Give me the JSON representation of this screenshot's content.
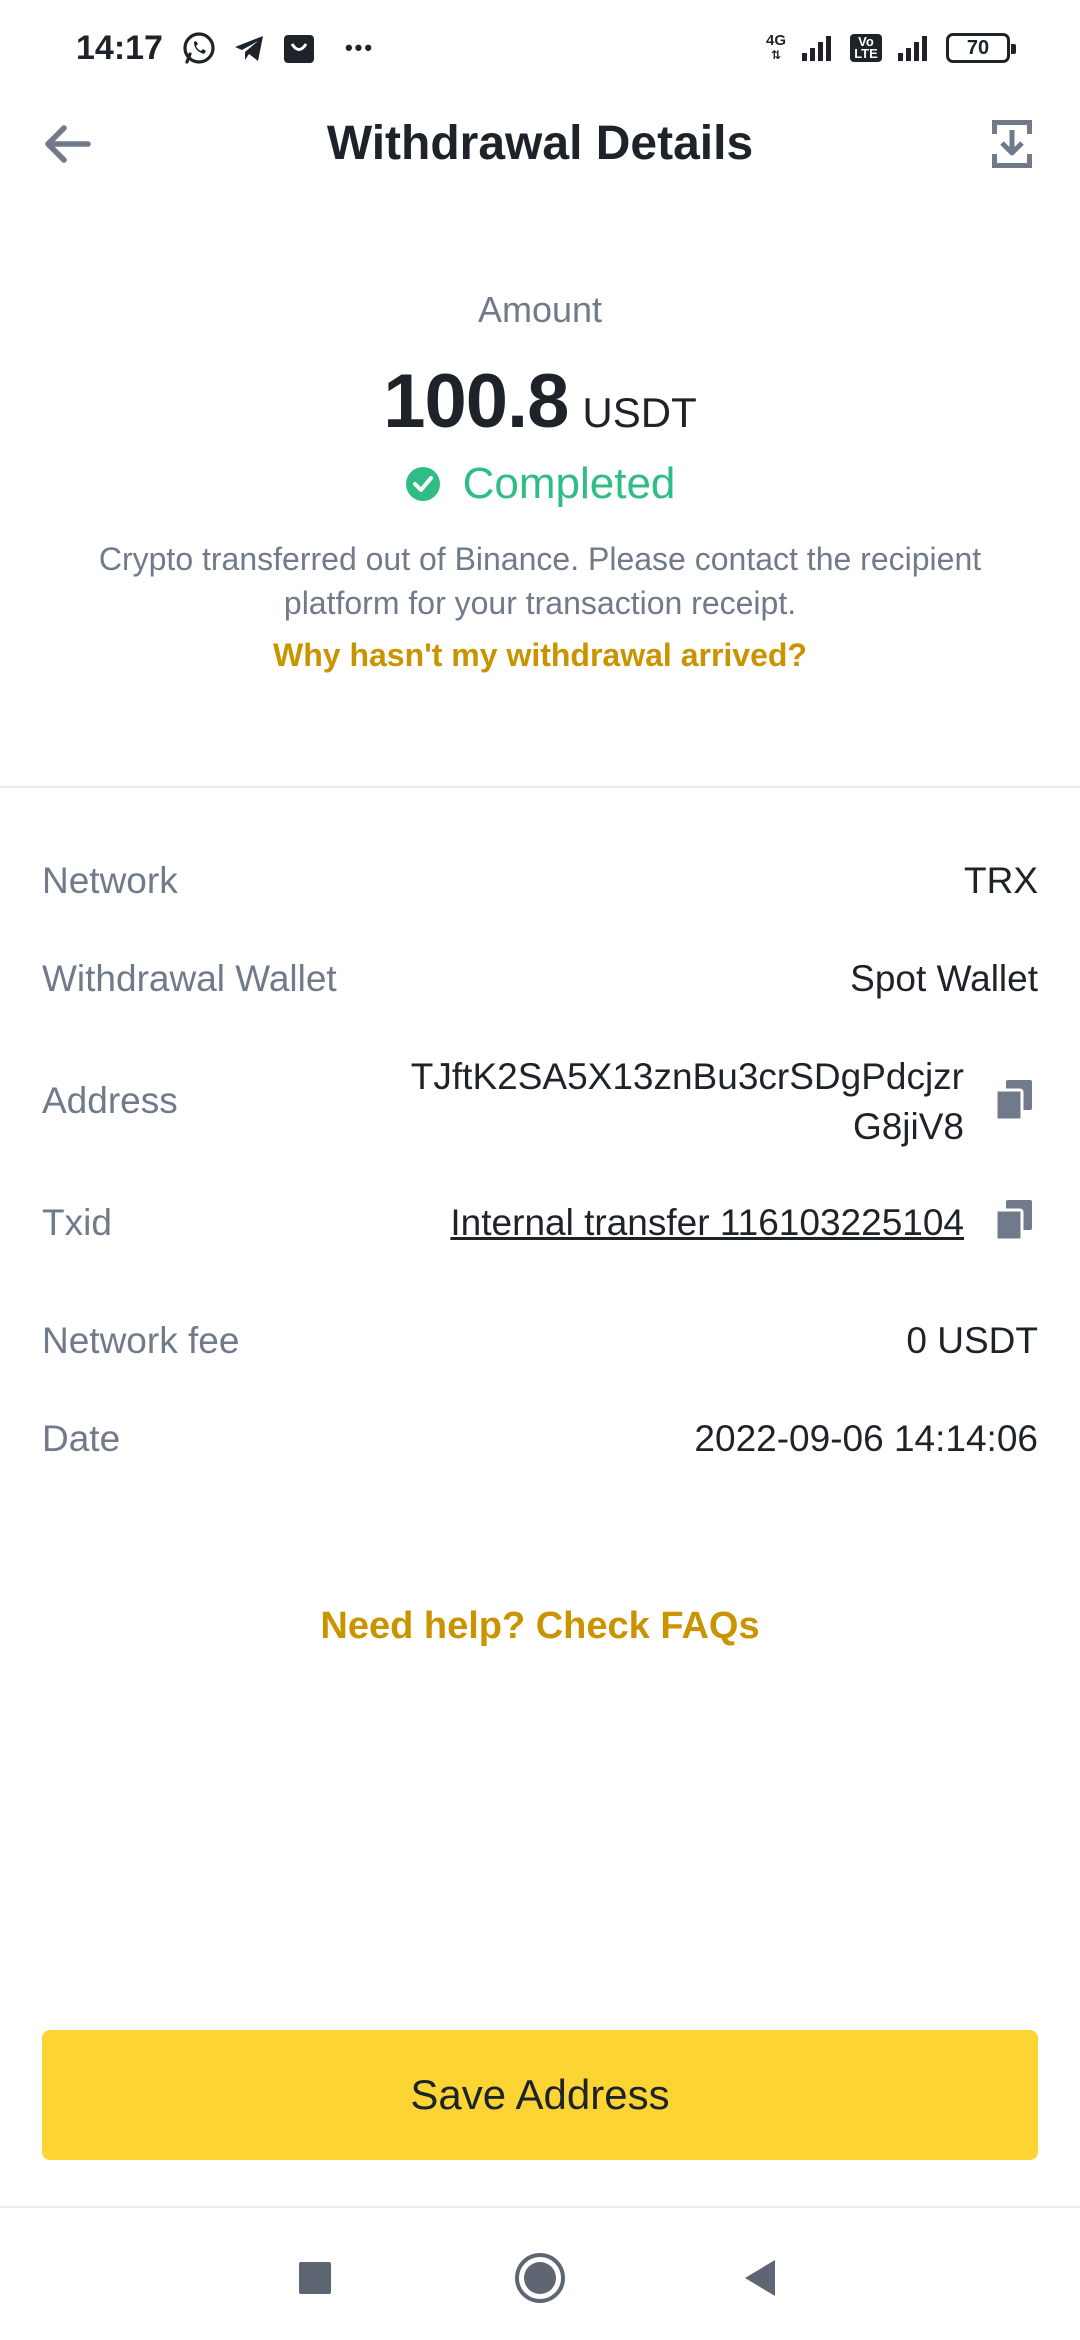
{
  "status_bar": {
    "time": "14:17",
    "network_label": "4G",
    "volte_label_top": "Vo",
    "volte_label_bottom": "LTE",
    "battery": "70",
    "more_glyph": "•••"
  },
  "header": {
    "title": "Withdrawal Details",
    "back_icon": "arrow-left-icon",
    "download_icon": "download-icon"
  },
  "summary": {
    "amount_label": "Amount",
    "amount_value": "100.8",
    "amount_unit": "USDT",
    "status": "Completed",
    "status_color": "#2ebd85",
    "notice": "Crypto transferred out of Binance. Please contact the recipient platform for your transaction receipt.",
    "why_link": "Why hasn't my withdrawal arrived?"
  },
  "details": {
    "network": {
      "label": "Network",
      "value": "TRX"
    },
    "wallet": {
      "label": "Withdrawal Wallet",
      "value": "Spot Wallet"
    },
    "address": {
      "label": "Address",
      "value": "TJftK2SA5X13znBu3crSDgPdcjzrG8jiV8"
    },
    "txid": {
      "label": "Txid",
      "value": "Internal transfer 116103225104"
    },
    "fee": {
      "label": "Network fee",
      "value": "0 USDT"
    },
    "date": {
      "label": "Date",
      "value": "2022-09-06 14:14:06"
    }
  },
  "faq_link": "Need help? Check FAQs",
  "save_button": "Save Address",
  "colors": {
    "accent_link": "#c99400",
    "primary_button": "#fcd535",
    "text_primary": "#1e2329",
    "text_secondary": "#707a8a"
  }
}
